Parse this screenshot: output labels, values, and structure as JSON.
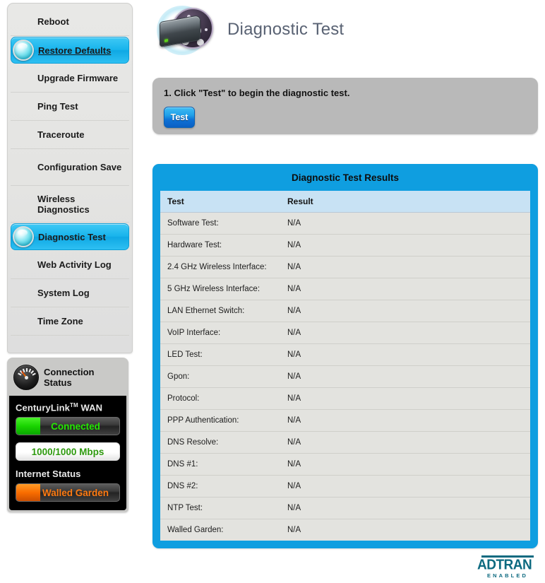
{
  "sidebar": {
    "items": [
      {
        "label": "Reboot",
        "state": "normal",
        "icon": null
      },
      {
        "label": "Restore Defaults",
        "state": "hover",
        "icon": "orb-icon"
      },
      {
        "label": "Upgrade Firmware",
        "state": "normal",
        "icon": null
      },
      {
        "label": "Ping Test",
        "state": "normal",
        "icon": null
      },
      {
        "label": "Traceroute",
        "state": "normal",
        "icon": null
      },
      {
        "label": "Configuration Save",
        "state": "normal",
        "icon": null
      },
      {
        "label": "Wireless Diagnostics",
        "state": "normal",
        "icon": null
      },
      {
        "label": "Diagnostic Test",
        "state": "selected",
        "icon": "orb-icon"
      },
      {
        "label": "Web Activity Log",
        "state": "normal",
        "icon": null
      },
      {
        "label": "System Log",
        "state": "normal",
        "icon": null
      },
      {
        "label": "Time Zone",
        "state": "normal",
        "icon": null
      }
    ]
  },
  "connection_status": {
    "title": "Connection Status",
    "icon": "gauge-icon",
    "wan_label": "CenturyLink",
    "wan_trademark": "TM",
    "wan_suffix": "WAN",
    "wan_status": "Connected",
    "wan_status_color": "#23e800",
    "speed": "1000/1000 Mbps",
    "speed_color": "#2e9a0e",
    "internet_label": "Internet Status",
    "internet_status": "Walled Garden",
    "internet_status_color": "#ff7a10"
  },
  "header": {
    "title": "Diagnostic Test",
    "icon": "disk-diagnostic-icon"
  },
  "instructions": {
    "text": "1. Click \"Test\" to begin the diagnostic test.",
    "button_label": "Test",
    "button_color": "#1f9fe8"
  },
  "results": {
    "title": "Diagnostic Test Results",
    "panel_color": "#0f9ee0",
    "columns": [
      "Test",
      "Result"
    ],
    "rows": [
      {
        "test": "Software Test:",
        "result": "N/A"
      },
      {
        "test": "Hardware Test:",
        "result": "N/A"
      },
      {
        "test": "2.4 GHz Wireless Interface:",
        "result": "N/A"
      },
      {
        "test": "5 GHz Wireless Interface:",
        "result": "N/A"
      },
      {
        "test": "LAN Ethernet Switch:",
        "result": "N/A"
      },
      {
        "test": "VoIP Interface:",
        "result": "N/A"
      },
      {
        "test": "LED Test:",
        "result": "N/A"
      },
      {
        "test": "Gpon:",
        "result": "N/A"
      },
      {
        "test": "Protocol:",
        "result": "N/A"
      },
      {
        "test": "PPP Authentication:",
        "result": "N/A"
      },
      {
        "test": "DNS Resolve:",
        "result": "N/A"
      },
      {
        "test": "DNS #1:",
        "result": "N/A"
      },
      {
        "test": "DNS #2:",
        "result": "N/A"
      },
      {
        "test": "NTP Test:",
        "result": "N/A"
      },
      {
        "test": "Walled Garden:",
        "result": "N/A"
      }
    ]
  },
  "footer": {
    "logo_word": "ADTRAN",
    "logo_sub": "ENABLED",
    "logo_color": "#0d6a80"
  }
}
